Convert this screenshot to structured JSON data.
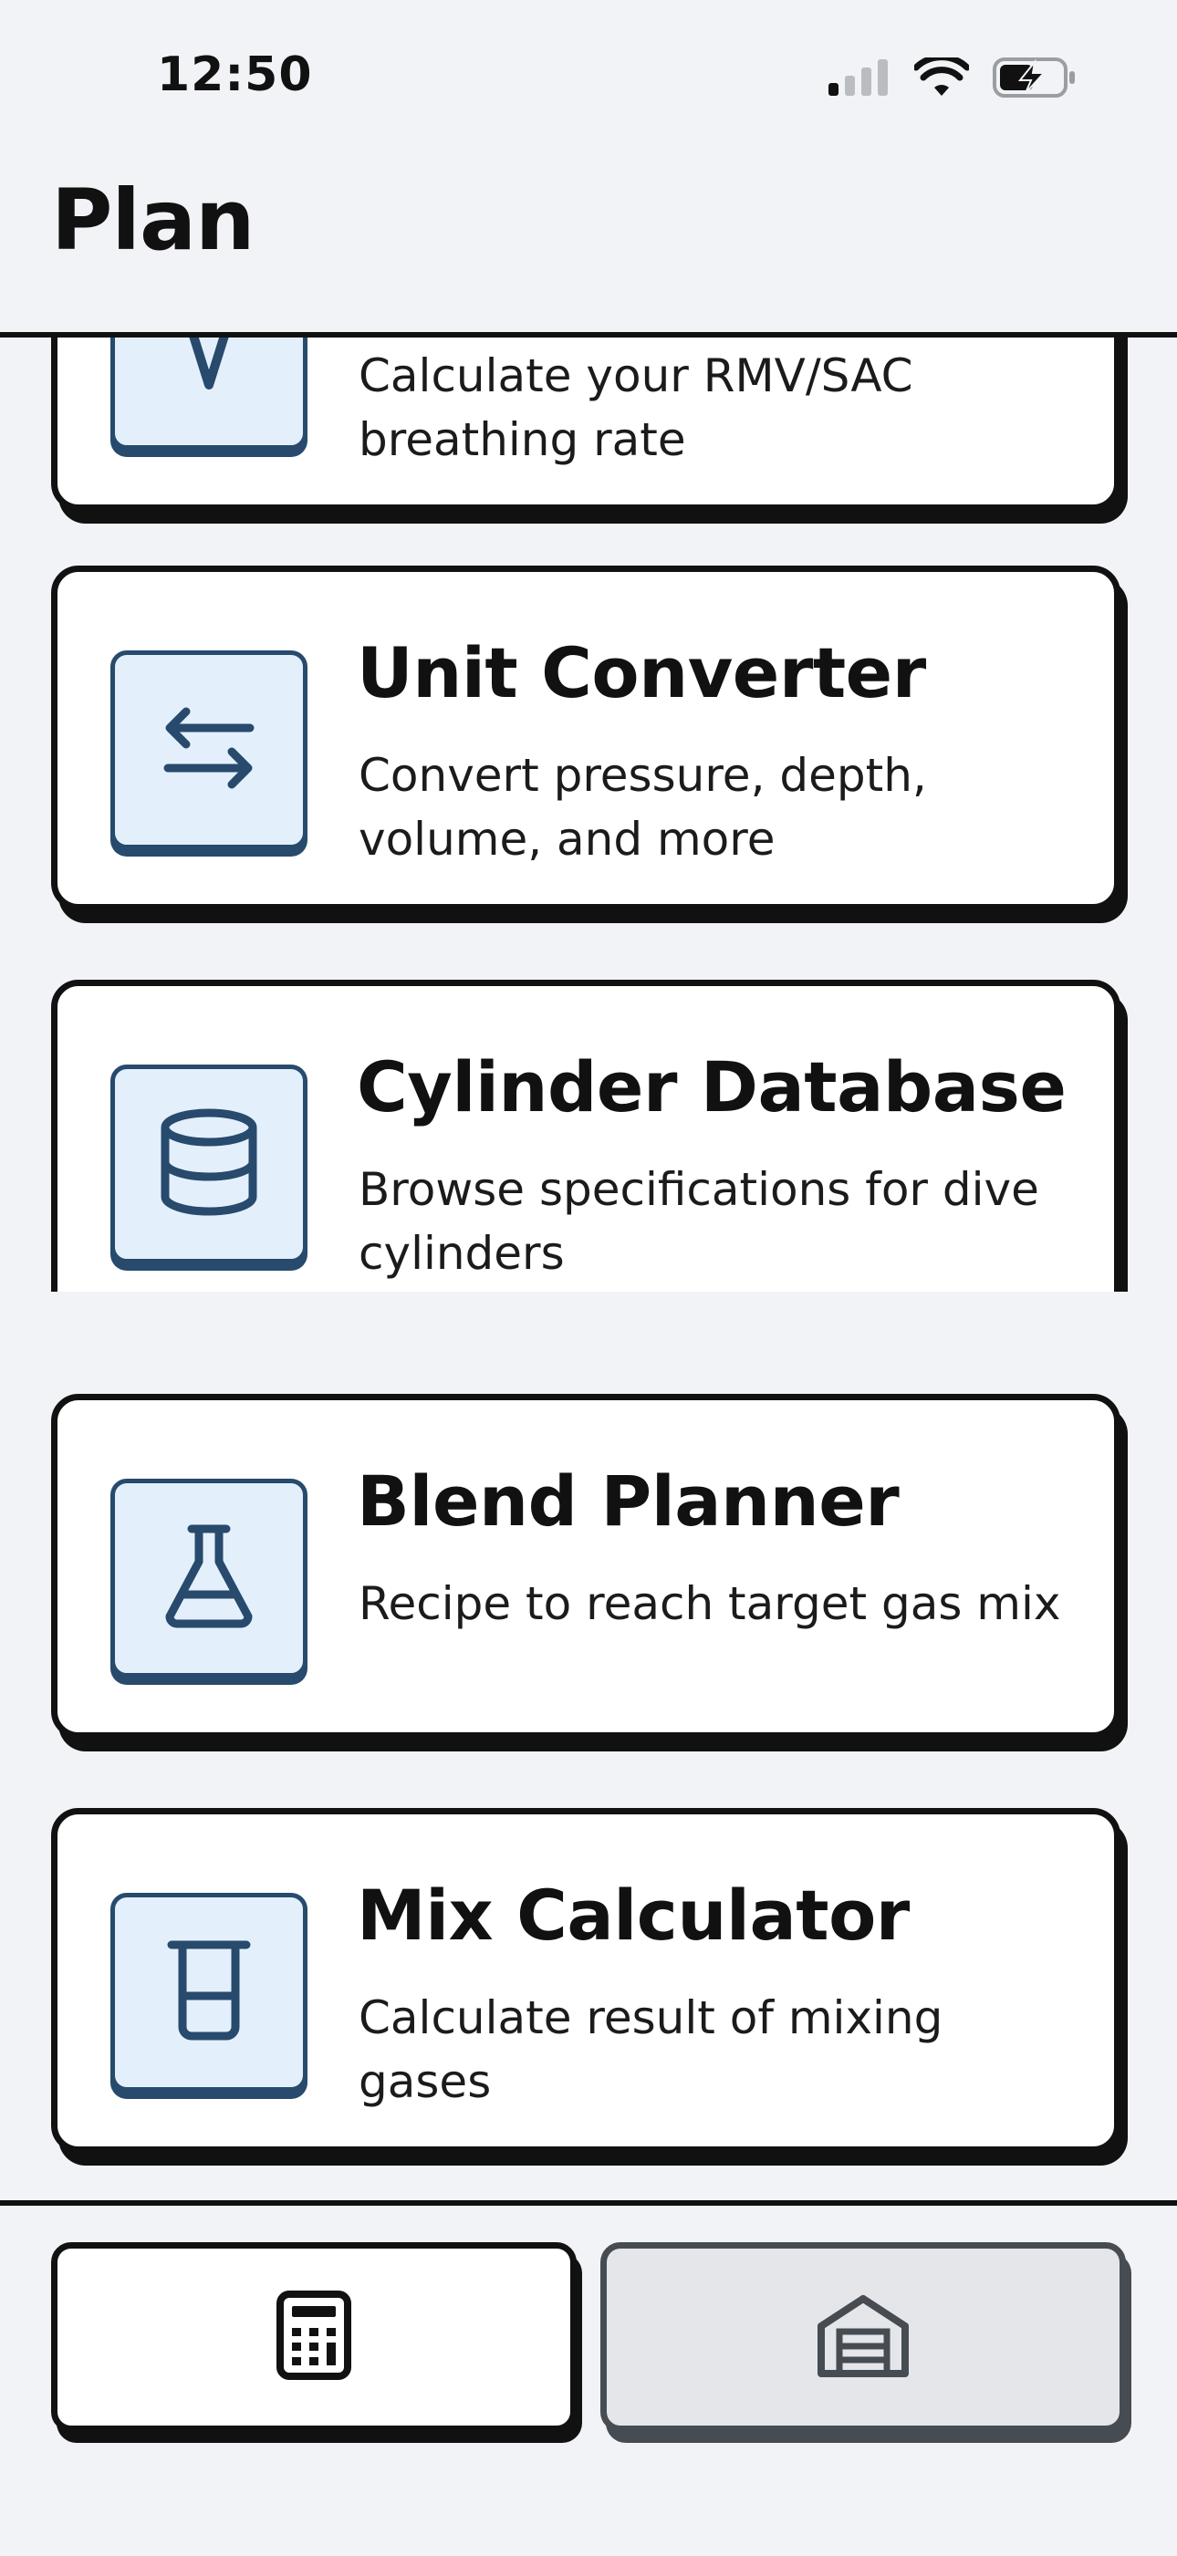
{
  "status_bar": {
    "time": "12:50"
  },
  "header": {
    "title": "Plan"
  },
  "tools": [
    {
      "title": "",
      "description": "Calculate your RMV/SAC breathing rate",
      "icon": "gauge-icon"
    },
    {
      "title": "Unit Converter",
      "description": "Convert pressure, depth, volume, and more",
      "icon": "arrows-exchange-icon"
    },
    {
      "title": "Cylinder Database",
      "description": "Browse specifications for dive cylinders",
      "icon": "database-cylinder-icon"
    },
    {
      "title": "Blend Planner",
      "description": "Recipe to reach target gas mix",
      "icon": "flask-icon"
    },
    {
      "title": "Mix Calculator",
      "description": "Calculate result of mixing gases",
      "icon": "beaker-icon"
    }
  ],
  "tab_bar": {
    "tabs": [
      {
        "name": "calculator-tab",
        "icon": "calculator-icon",
        "selected": true
      },
      {
        "name": "garage-tab",
        "icon": "garage-icon",
        "selected": false
      }
    ]
  },
  "colors": {
    "accent": "#274a6d",
    "icon_bg": "#e3f0fb",
    "background": "#f1f3f6",
    "ink": "#111111"
  }
}
